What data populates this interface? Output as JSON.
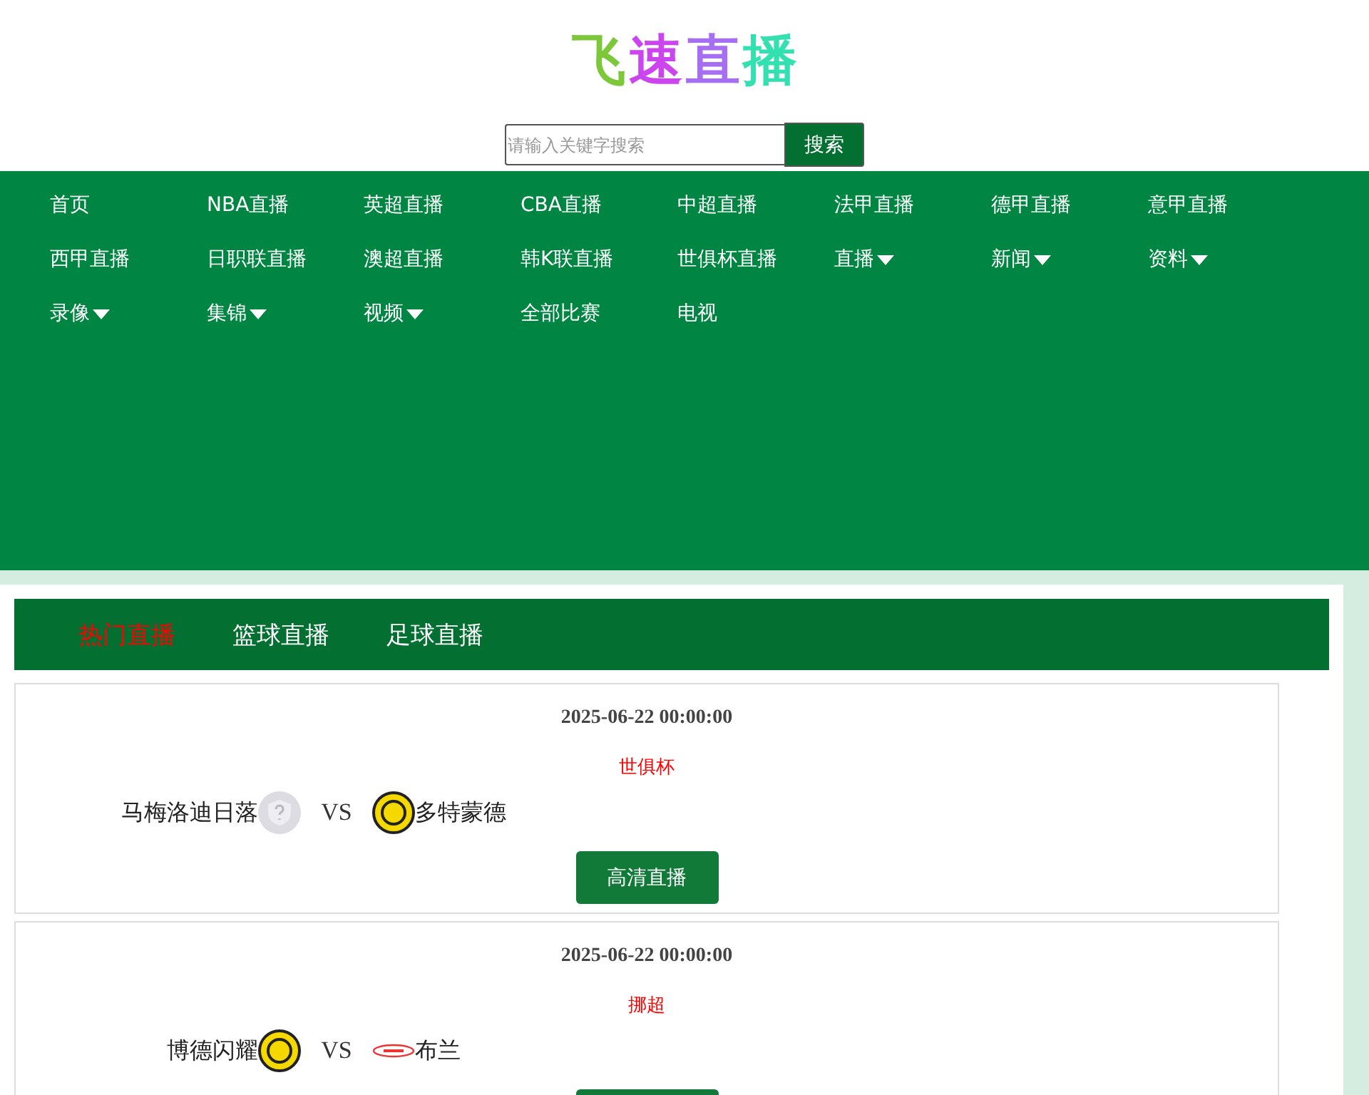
{
  "logo": {
    "chars": [
      {
        "text": "飞",
        "color": "#7cc83a"
      },
      {
        "text": "速",
        "color": "#cc44ee"
      },
      {
        "text": "直",
        "color": "#a66ef0"
      },
      {
        "text": "播",
        "color": "#33e0b0"
      }
    ]
  },
  "search": {
    "placeholder": "请输入关键字搜索",
    "button": "搜索"
  },
  "nav": [
    {
      "label": "首页",
      "dropdown": false
    },
    {
      "label": "NBA直播",
      "dropdown": false
    },
    {
      "label": "英超直播",
      "dropdown": false
    },
    {
      "label": "CBA直播",
      "dropdown": false
    },
    {
      "label": "中超直播",
      "dropdown": false
    },
    {
      "label": "法甲直播",
      "dropdown": false
    },
    {
      "label": "德甲直播",
      "dropdown": false
    },
    {
      "label": "意甲直播",
      "dropdown": false
    },
    {
      "label": "西甲直播",
      "dropdown": false
    },
    {
      "label": "日职联直播",
      "dropdown": false
    },
    {
      "label": "澳超直播",
      "dropdown": false
    },
    {
      "label": "韩K联直播",
      "dropdown": false
    },
    {
      "label": "世俱杯直播",
      "dropdown": false
    },
    {
      "label": "直播",
      "dropdown": true
    },
    {
      "label": "新闻",
      "dropdown": true
    },
    {
      "label": "资料",
      "dropdown": true
    },
    {
      "label": "录像",
      "dropdown": true
    },
    {
      "label": "集锦",
      "dropdown": true
    },
    {
      "label": "视频",
      "dropdown": true
    },
    {
      "label": "全部比赛",
      "dropdown": false
    },
    {
      "label": "电视",
      "dropdown": false
    }
  ],
  "tabs": [
    {
      "label": "热门直播",
      "selected": true
    },
    {
      "label": "篮球直播",
      "selected": false
    },
    {
      "label": "足球直播",
      "selected": false
    }
  ],
  "matches": [
    {
      "time": "2025-06-22 00:00:00",
      "league": "世俱杯",
      "home": "马梅洛迪日落",
      "home_crest": {
        "kind": "unknown"
      },
      "vs": "VS",
      "away": "多特蒙德",
      "away_crest": {
        "kind": "yellow"
      },
      "button_label": "高清直播"
    },
    {
      "time": "2025-06-22 00:00:00",
      "league": "挪超",
      "home": "博德闪耀",
      "home_crest": {
        "kind": "yellow"
      },
      "vs": "VS",
      "away": "布兰",
      "away_crest": {
        "kind": "oval"
      }
    }
  ]
}
